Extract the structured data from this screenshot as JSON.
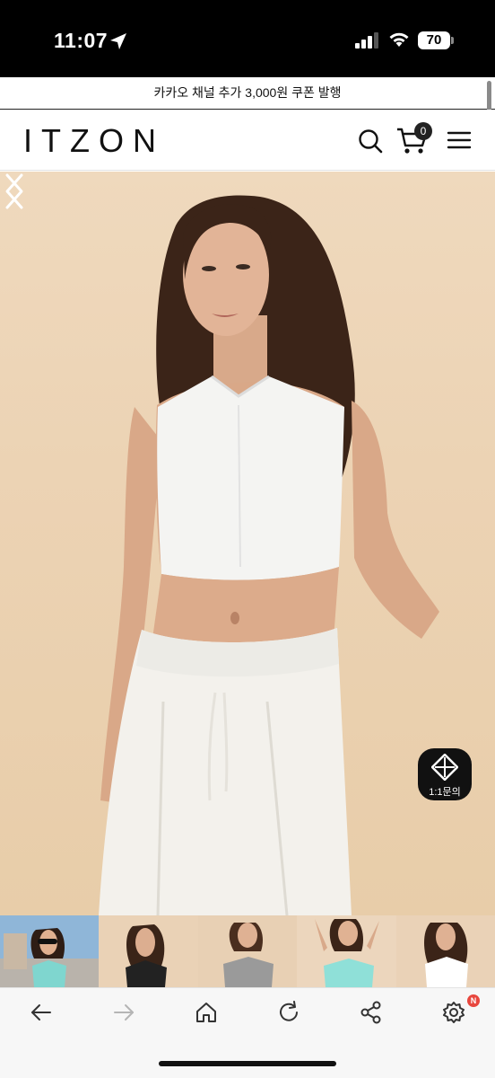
{
  "status_bar": {
    "time": "11:07",
    "battery": "70",
    "icons": [
      "location-arrow-icon",
      "cellular-signal-icon",
      "wifi-icon",
      "battery-icon"
    ]
  },
  "promo": {
    "text": "카카오 채널 추가 3,000원 쿠폰 발행"
  },
  "header": {
    "logo": "ITZON",
    "cart_count": "0",
    "icons": [
      "search-icon",
      "cart-icon",
      "menu-icon"
    ]
  },
  "hero": {
    "prev_icon": "chevron-left-icon",
    "next_icon": "chevron-right-icon",
    "background_color": "#ecd3b4"
  },
  "chat": {
    "label": "1:1문의",
    "icon": "diamond-compass-icon"
  },
  "thumbnails": [
    {
      "top_color": "#7fd6cf"
    },
    {
      "top_color": "#222222"
    },
    {
      "top_color": "#9a9a9a"
    },
    {
      "top_color": "#8fe0d8"
    },
    {
      "top_color": "#ffffff"
    }
  ],
  "browser_toolbar": {
    "buttons": [
      "back-icon",
      "forward-icon",
      "home-icon",
      "reload-icon",
      "share-icon",
      "settings-icon"
    ],
    "settings_badge": "N"
  }
}
